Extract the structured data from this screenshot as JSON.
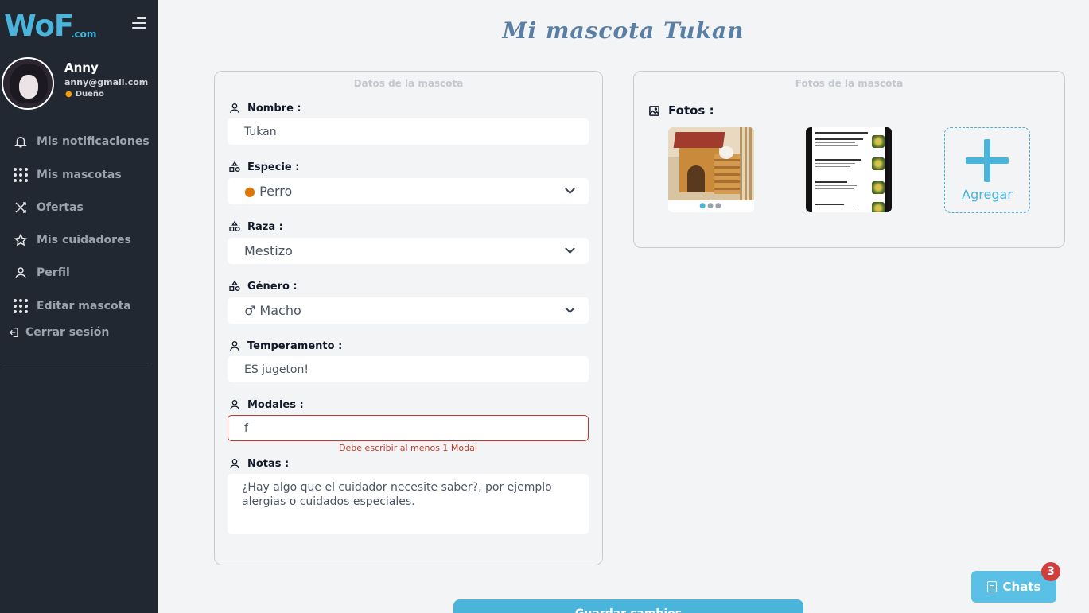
{
  "sidebar": {
    "logo_text": "WoF",
    "logo_suffix": ".com",
    "user": {
      "name": "Anny",
      "email": "anny@gmail.com",
      "role": "Dueño"
    },
    "items": [
      {
        "label": "Mis notificaciones",
        "icon": "bell-icon"
      },
      {
        "label": "Mis mascotas",
        "icon": "grid-icon"
      },
      {
        "label": "Ofertas",
        "icon": "shuffle-icon"
      },
      {
        "label": "Mis cuidadores",
        "icon": "star-icon"
      },
      {
        "label": "Perfil",
        "icon": "user-icon"
      },
      {
        "label": "Editar mascota",
        "icon": "grid-icon"
      }
    ],
    "logout_label": "Cerrar sesión"
  },
  "page": {
    "title": "Mi mascota Tukan"
  },
  "pet_form": {
    "title": "Datos de la mascota",
    "nombre": {
      "label": "Nombre :",
      "value": "Tukan"
    },
    "especie": {
      "label": "Especie :",
      "value": "Perro",
      "icon": "dog-face-icon"
    },
    "raza": {
      "label": "Raza :",
      "value": "Mestizo"
    },
    "genero": {
      "label": "Género :",
      "value": "♂ Macho"
    },
    "temperamento": {
      "label": "Temperamento :",
      "value": "ES jugeton!"
    },
    "modales": {
      "label": "Modales :",
      "value": "f",
      "error": "Debe escribir al menos 1 Modal"
    },
    "notas": {
      "label": "Notas :",
      "placeholder": "¿Hay algo que el cuidador necesite saber?, por ejemplo alergias o cuidados especiales."
    }
  },
  "photos": {
    "title": "Fotos de la mascota",
    "label": "Fotos :",
    "add_label": "Agregar"
  },
  "actions": {
    "save_label": "Guardar cambios"
  },
  "chats": {
    "label": "Chats",
    "count": "3"
  },
  "colors": {
    "accent": "#4ab4db",
    "sidebar_bg": "#222831",
    "error": "#c0392b"
  }
}
